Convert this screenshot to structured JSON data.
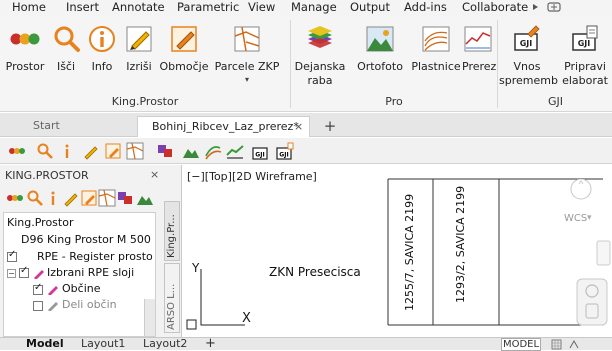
{
  "menu": {
    "items": [
      "Home",
      "Insert",
      "Annotate",
      "Parametric",
      "View",
      "Manage",
      "Output",
      "Add-ins",
      "Collaborate"
    ],
    "overflow": "▸"
  },
  "ribbon": {
    "kingprostor": {
      "label": "King.Prostor",
      "buttons": [
        "Prostor",
        "Išči",
        "Info",
        "Izriši",
        "Območje",
        "Parcele ZKP"
      ]
    },
    "pro": {
      "label": "Pro",
      "buttons": [
        "Dejanska\nraba",
        "Ortofoto",
        "Plastnice",
        "Prerez"
      ],
      "dejanska_line1": "Dejanska",
      "dejanska_line2": "raba"
    },
    "gji": {
      "label": "GJI",
      "vnos_line1": "Vnos",
      "vnos_line2": "sprememb",
      "pripravi_line1": "Pripravi",
      "pripravi_line2": "elaborat",
      "icon_text": "GJI"
    }
  },
  "doc_tabs": {
    "start": "Start",
    "drawing": "Bohinj_Ribcev_Laz_prerez*",
    "close": "×",
    "add": "+"
  },
  "panel": {
    "title": "KING.PROSTOR",
    "close": "×",
    "tree": [
      "King.Prostor",
      "D96 King Prostor M 500",
      "RPE - Register prosto",
      "Izbrani RPE sloji",
      "Občine",
      "Deli občin"
    ],
    "vtabs": [
      "King.Pr...",
      "ARSO L..."
    ]
  },
  "canvas": {
    "view_label": "[−][Top][2D Wireframe]",
    "zkn_text": "ZKN Presecisca",
    "parcel_1": "1255/7, SAVICA 2199",
    "parcel_2": "1293/2, SAVICA 2199",
    "wcs": "WCS",
    "axis_y": "Y",
    "axis_x": "X"
  },
  "status": {
    "model": "Model",
    "layout1": "Layout1",
    "layout2": "Layout2",
    "add": "+",
    "mode": "MODEL"
  },
  "colors": {
    "ribbon_bg": "#f5f5f5",
    "accent_orange": "#e8821e"
  }
}
